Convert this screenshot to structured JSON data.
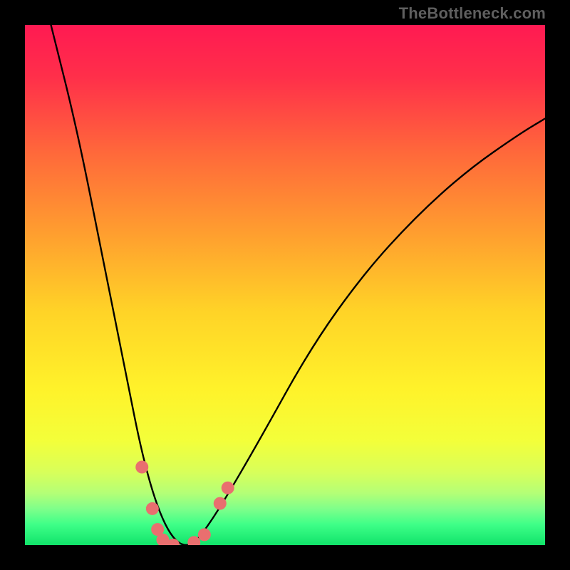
{
  "watermark": "TheBottleneck.com",
  "chart_data": {
    "type": "line",
    "title": "",
    "xlabel": "",
    "ylabel": "",
    "xlim": [
      0,
      100
    ],
    "ylim": [
      0,
      100
    ],
    "grid": false,
    "legend": false,
    "series": [
      {
        "name": "bottleneck-curve",
        "x": [
          5,
          10,
          15,
          20,
          22,
          24,
          26,
          28,
          30,
          32,
          34,
          38,
          45,
          55,
          65,
          75,
          85,
          95,
          100
        ],
        "y": [
          100,
          80,
          55,
          30,
          20,
          12,
          6,
          2,
          0,
          0,
          2,
          8,
          20,
          38,
          52,
          63,
          72,
          79,
          82
        ]
      }
    ],
    "markers": [
      {
        "name": "left-dot-upper",
        "x": 22.5,
        "y": 15
      },
      {
        "name": "left-dot-mid",
        "x": 24.5,
        "y": 7
      },
      {
        "name": "left-dot-low1",
        "x": 25.5,
        "y": 3
      },
      {
        "name": "left-dot-low2",
        "x": 26.5,
        "y": 1
      },
      {
        "name": "bottom-dot-1",
        "x": 28.5,
        "y": 0
      },
      {
        "name": "bottom-dot-2",
        "x": 32.5,
        "y": 0.5
      },
      {
        "name": "right-dot-low",
        "x": 34.5,
        "y": 2
      },
      {
        "name": "right-dot-upper",
        "x": 37.5,
        "y": 8
      },
      {
        "name": "right-dot-top",
        "x": 39,
        "y": 11
      }
    ],
    "background_gradient": {
      "stops": [
        {
          "pos": 0.0,
          "color": "#ff1a52"
        },
        {
          "pos": 0.1,
          "color": "#ff2f4a"
        },
        {
          "pos": 0.25,
          "color": "#ff6a3a"
        },
        {
          "pos": 0.4,
          "color": "#ff9e2f"
        },
        {
          "pos": 0.55,
          "color": "#ffd327"
        },
        {
          "pos": 0.7,
          "color": "#fff22a"
        },
        {
          "pos": 0.8,
          "color": "#f3ff3a"
        },
        {
          "pos": 0.86,
          "color": "#d8ff5a"
        },
        {
          "pos": 0.9,
          "color": "#b4ff76"
        },
        {
          "pos": 0.93,
          "color": "#7fff8a"
        },
        {
          "pos": 0.96,
          "color": "#3fff88"
        },
        {
          "pos": 1.0,
          "color": "#11e36a"
        }
      ]
    },
    "marker_style": {
      "color": "#e96f6f",
      "radius_px": 9
    }
  }
}
